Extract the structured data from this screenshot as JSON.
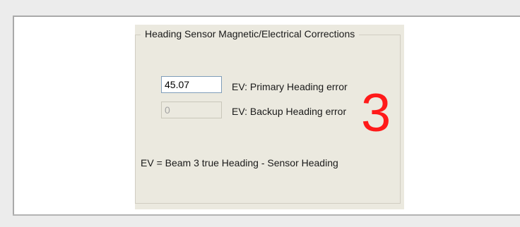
{
  "group": {
    "title": "Heading Sensor Magnetic/Electrical Corrections"
  },
  "primary": {
    "value": "45.07",
    "label": "EV:  Primary Heading error"
  },
  "backup": {
    "value": "0",
    "label": "EV:  Backup Heading error"
  },
  "formula": "EV = Beam 3 true Heading - Sensor Heading",
  "annotation": {
    "text": "3",
    "color": "#ff1a1a"
  }
}
